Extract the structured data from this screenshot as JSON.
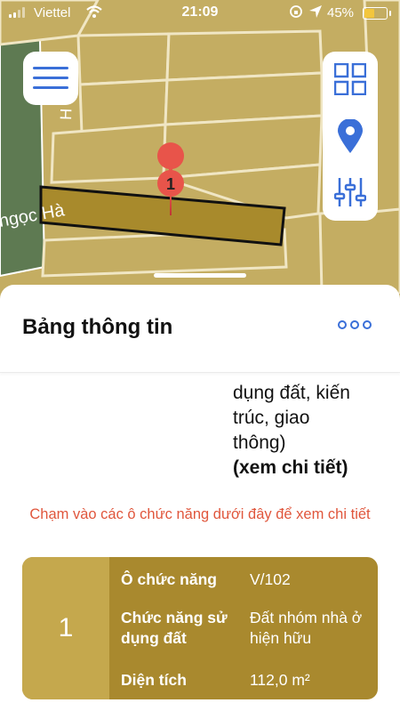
{
  "status_bar": {
    "carrier": "Viettel",
    "time": "21:09",
    "battery": "45%"
  },
  "map": {
    "street_labels": [
      "Ngọc Hà",
      "Ngọc",
      "H",
      "59 T"
    ],
    "marker_label": "1"
  },
  "sheet": {
    "title": "Bảng thông tin",
    "partial_text_lines": [
      "dụng đất, kiến",
      "trúc, giao",
      "thông)"
    ],
    "detail_link": "(xem chi tiết)",
    "hint": "Chạm vào các ô chức năng dưới đây để xem chi tiết",
    "card": {
      "number": "1",
      "rows": [
        {
          "label": "Ô chức năng",
          "value": "V/102"
        },
        {
          "label": "Chức năng sử dụng đất",
          "value": "Đất nhóm nhà ở hiện hữu"
        },
        {
          "label": "Diện tích",
          "value": "112,0 m²"
        }
      ]
    }
  },
  "icons": [
    "wifi-icon",
    "rotation-lock-icon",
    "location-arrow-icon",
    "battery-icon",
    "hamburger-menu-icon",
    "grid-layers-icon",
    "location-pin-icon",
    "filter-sliders-icon",
    "more-options-icon"
  ],
  "colors": {
    "accent": "#3a6fd8",
    "hint": "#e0563c",
    "card_bg": "#a9892e",
    "card_num_bg": "#c5a84d",
    "parcel": "#a88a2c"
  }
}
